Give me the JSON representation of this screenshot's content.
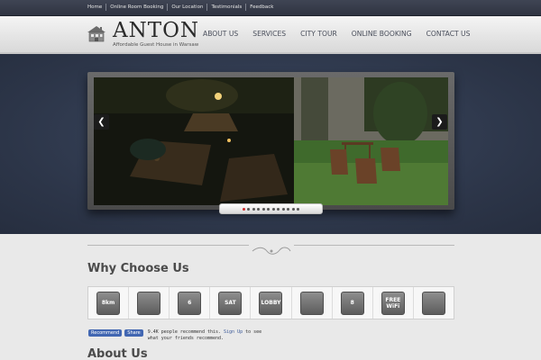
{
  "topbar": {
    "links": [
      "Home",
      "Online Room Booking",
      "Our Location",
      "Testimonials",
      "Feedback"
    ]
  },
  "header": {
    "logo_title": "ANTON",
    "logo_tagline": "Affordable Guest House in Warsaw",
    "nav": [
      "ABOUT US",
      "SERVICES",
      "CITY TOUR",
      "ONLINE BOOKING",
      "CONTACT US"
    ]
  },
  "slider": {
    "prev_icon": "chevron-left-icon",
    "next_icon": "chevron-right-icon",
    "prev_glyph": "❮",
    "next_glyph": "❯",
    "slide_count": 12,
    "active_slide": 1
  },
  "why_choose": {
    "title": "Why Choose Us",
    "features": [
      {
        "icon": "distance-bus-icon",
        "label": "8km"
      },
      {
        "icon": "playground-icon",
        "label": ""
      },
      {
        "icon": "building-icon",
        "label": "6"
      },
      {
        "icon": "satellite-tv-icon",
        "label": "SAT"
      },
      {
        "icon": "lobby-icon",
        "label": "LOBBY"
      },
      {
        "icon": "restaurant-icon",
        "label": ""
      },
      {
        "icon": "billiards-icon",
        "label": "8"
      },
      {
        "icon": "wifi-icon",
        "label": "FREE WiFi"
      },
      {
        "icon": "garden-icon",
        "label": ""
      }
    ]
  },
  "facebook": {
    "recommend_label": "Recommend",
    "share_label": "Share",
    "count_text": "9.4K people recommend this.",
    "signup_label": "Sign Up",
    "suffix_text": "to see",
    "line2": "what your friends recommend."
  },
  "about": {
    "title": "About Us"
  },
  "colors": {
    "topbar": "#2f3441",
    "hero": "#2c3548",
    "accent_dot": "#d02a2a",
    "fb_blue": "#4267b2"
  }
}
